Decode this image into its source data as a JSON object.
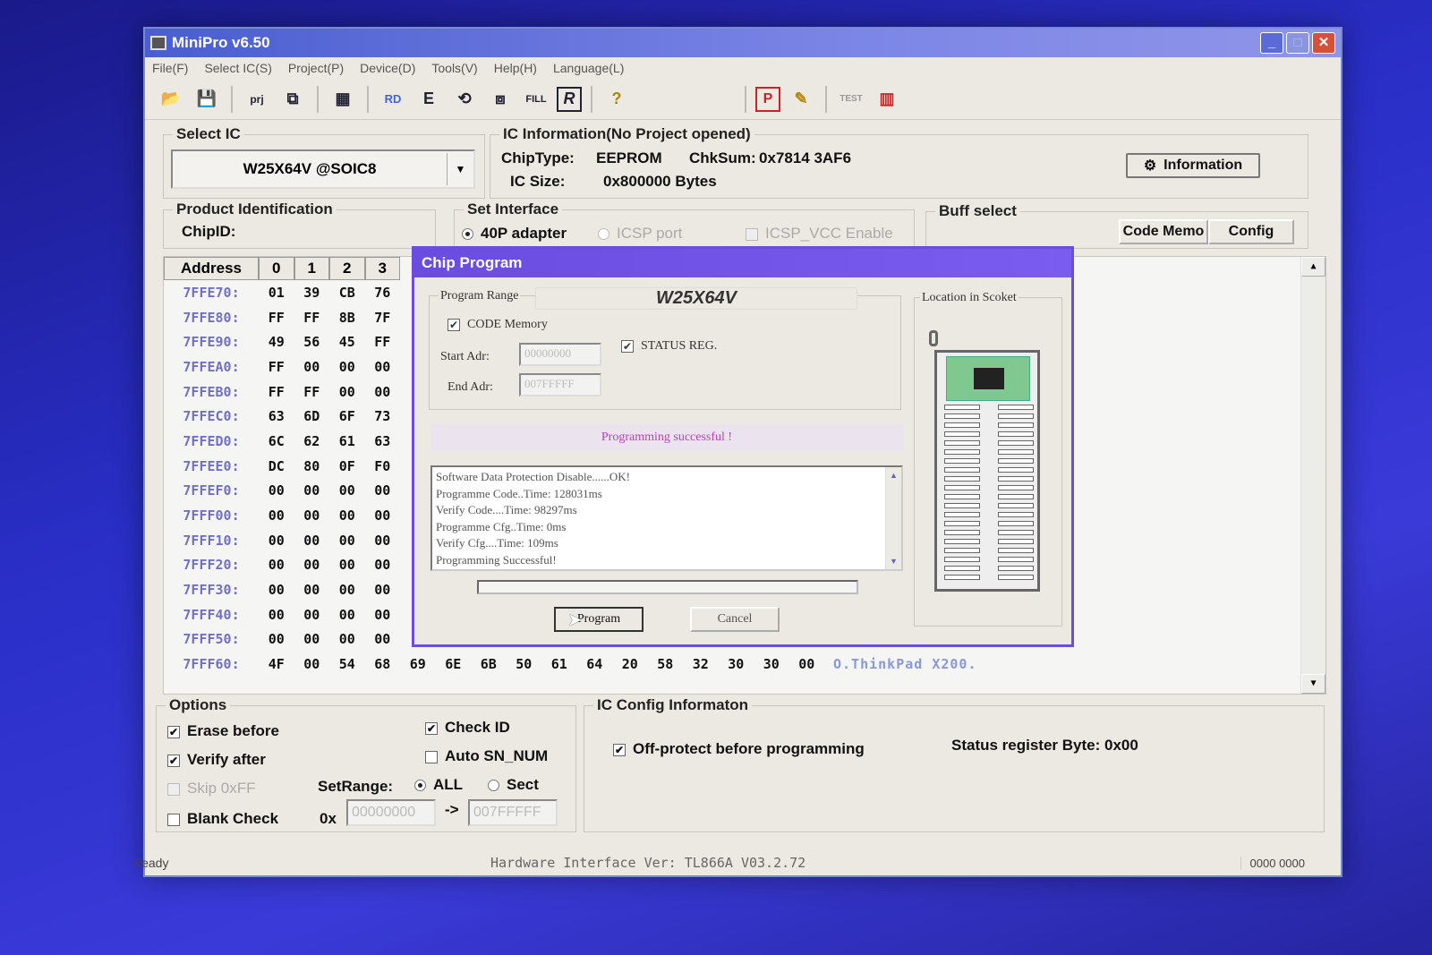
{
  "window": {
    "title": "MiniPro v6.50",
    "min": "_",
    "max": "□",
    "close": "✕"
  },
  "menu": [
    "File(F)",
    "Select IC(S)",
    "Project(P)",
    "Device(D)",
    "Tools(V)",
    "Help(H)",
    "Language(L)"
  ],
  "toolbar": {
    "left": [
      {
        "name": "open-icon",
        "glyph": "📂"
      },
      {
        "name": "save-icon",
        "glyph": "💾"
      },
      {
        "name": "open-project-icon",
        "glyph": "prj"
      },
      {
        "name": "save-project-icon",
        "glyph": "⧉"
      },
      {
        "name": "chip-info-icon",
        "glyph": "▦"
      },
      {
        "name": "read-icon",
        "glyph": "RD"
      },
      {
        "name": "erase-icon",
        "glyph": "E"
      },
      {
        "name": "verify-icon",
        "glyph": "⟲"
      },
      {
        "name": "blank-check-icon",
        "glyph": "⧈"
      },
      {
        "name": "fill-icon",
        "glyph": "FILL"
      },
      {
        "name": "protect-icon",
        "glyph": "R"
      },
      {
        "name": "help-icon",
        "glyph": "?"
      }
    ],
    "right": [
      {
        "name": "program-icon",
        "glyph": "P"
      },
      {
        "name": "edit-icon",
        "glyph": "✎"
      },
      {
        "name": "test-icon",
        "glyph": "TEST"
      },
      {
        "name": "socket-icon",
        "glyph": "▥"
      }
    ]
  },
  "select_ic": {
    "label": "Select IC",
    "value": "W25X64V @SOIC8"
  },
  "ic_info": {
    "label": "IC Information(No Project opened)",
    "chiptype_label": "ChipType:",
    "chiptype": "EEPROM",
    "chksum_label": "ChkSum:",
    "chksum": "0x7814 3AF6",
    "size_label": "IC Size:",
    "size": "0x800000 Bytes",
    "info_button": "Information"
  },
  "product_id": {
    "label": "Product Identification",
    "chipid_label": "ChipID:"
  },
  "set_interface": {
    "label": "Set Interface",
    "opt1": "40P adapter",
    "opt2": "ICSP port",
    "opt3": "ICSP_VCC Enable"
  },
  "buff_select": {
    "label": "Buff select",
    "tab1": "Code Memo",
    "tab2": "Config"
  },
  "hex": {
    "headers": [
      "Address",
      "0",
      "1",
      "2",
      "3"
    ],
    "rows": [
      {
        "addr": "7FFE70:",
        "cells": [
          "01",
          "39",
          "CB",
          "76"
        ]
      },
      {
        "addr": "7FFE80:",
        "cells": [
          "FF",
          "FF",
          "8B",
          "7F"
        ]
      },
      {
        "addr": "7FFE90:",
        "cells": [
          "49",
          "56",
          "45",
          "FF"
        ]
      },
      {
        "addr": "7FFEA0:",
        "cells": [
          "FF",
          "00",
          "00",
          "00"
        ]
      },
      {
        "addr": "7FFEB0:",
        "cells": [
          "FF",
          "FF",
          "00",
          "00"
        ]
      },
      {
        "addr": "7FFEC0:",
        "cells": [
          "63",
          "6D",
          "6F",
          "73"
        ]
      },
      {
        "addr": "7FFED0:",
        "cells": [
          "6C",
          "62",
          "61",
          "63"
        ]
      },
      {
        "addr": "7FFEE0:",
        "cells": [
          "DC",
          "80",
          "0F",
          "F0"
        ]
      },
      {
        "addr": "7FFEF0:",
        "cells": [
          "00",
          "00",
          "00",
          "00"
        ]
      },
      {
        "addr": "7FFF00:",
        "cells": [
          "00",
          "00",
          "00",
          "00"
        ]
      },
      {
        "addr": "7FFF10:",
        "cells": [
          "00",
          "00",
          "00",
          "00"
        ]
      },
      {
        "addr": "7FFF20:",
        "cells": [
          "00",
          "00",
          "00",
          "00"
        ]
      },
      {
        "addr": "7FFF30:",
        "cells": [
          "00",
          "00",
          "00",
          "00"
        ]
      },
      {
        "addr": "7FFF40:",
        "cells": [
          "00",
          "00",
          "00",
          "00"
        ]
      },
      {
        "addr": "7FFF50:",
        "cells": [
          "00",
          "00",
          "00",
          "00"
        ]
      },
      {
        "addr": "7FFF60:",
        "cells": [
          "4F",
          "00",
          "54",
          "68",
          "69",
          "6E",
          "6B",
          "50",
          "61",
          "64",
          "20",
          "58",
          "32",
          "30",
          "30",
          "00"
        ],
        "ascii": "O.ThinkPad X200."
      }
    ]
  },
  "options": {
    "label": "Options",
    "erase_before": "Erase before",
    "verify_after": "Verify after",
    "skip_ff": "Skip 0xFF",
    "blank_check": "Blank Check",
    "check_id": "Check ID",
    "auto_sn": "Auto SN_NUM",
    "setrange_label": "SetRange:",
    "range_all": "ALL",
    "range_sect": "Sect",
    "prefix": "0x",
    "start": "00000000",
    "arrow": "->",
    "end": "007FFFFF"
  },
  "ic_config": {
    "label": "IC Config Informaton",
    "off_protect": "Off-protect before programming",
    "status_byte": "Status register Byte: 0x00"
  },
  "status": {
    "left": "Ready",
    "center": "Hardware Interface Ver: TL866A V03.2.72",
    "right": "0000 0000"
  },
  "dialog": {
    "title": "Chip Program",
    "range_label": "Program Range",
    "chip_name": "W25X64V",
    "code_memory": "CODE Memory",
    "status_reg": "STATUS REG.",
    "start_label": "Start Adr:",
    "start_value": "00000000",
    "end_label": "End Adr:",
    "end_value": "007FFFFF",
    "location_label": "Location in Scoket",
    "status_message": "Programming successful !",
    "log": [
      "Software Data Protection Disable......OK!",
      "Programme Code..Time: 128031ms",
      "Verify Code....Time: 98297ms",
      "Programme Cfg..Time: 0ms",
      "Verify Cfg....Time: 109ms",
      "Programming Successful!"
    ],
    "progress": 0,
    "program_button": "Program",
    "cancel_button": "Cancel"
  },
  "colors": {
    "accent": "#6a4ce0",
    "titlebar": "#4a5ed0",
    "addr": "#7070c8",
    "success": "#c040c0"
  }
}
